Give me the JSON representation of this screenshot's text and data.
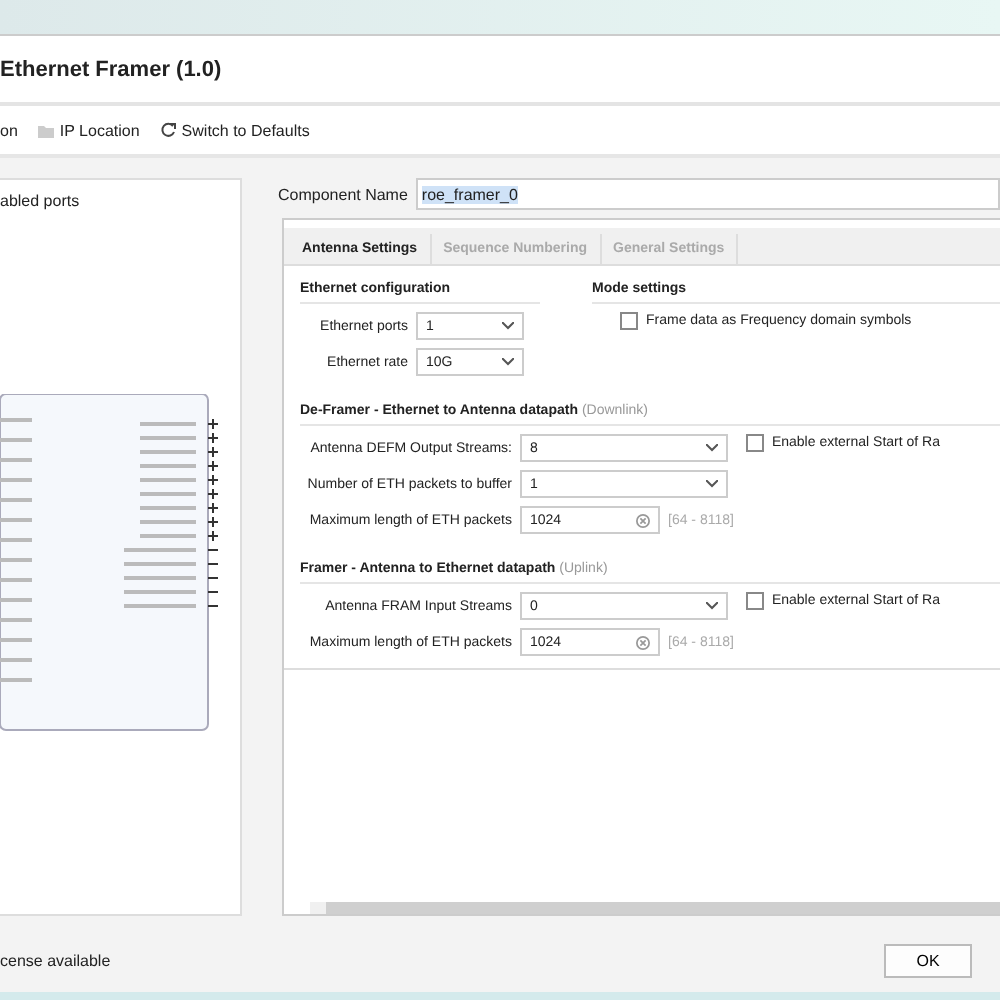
{
  "window": {
    "title": "Ethernet Framer (1.0)"
  },
  "toolbar": [
    {
      "label": "on",
      "kind": "text"
    },
    {
      "label": "IP Location",
      "kind": "folder"
    },
    {
      "label": "Switch to Defaults",
      "kind": "refresh"
    }
  ],
  "left_panel": {
    "header": "abled ports"
  },
  "component_name": {
    "label": "Component Name",
    "value": "roe_framer_0"
  },
  "tabs": [
    {
      "label": "Antenna Settings",
      "selected": true
    },
    {
      "label": "Sequence Numbering",
      "selected": false
    },
    {
      "label": "General Settings",
      "selected": false
    }
  ],
  "ethernet_config": {
    "title": "Ethernet configuration",
    "fields": [
      {
        "label": "Ethernet ports",
        "value": "1"
      },
      {
        "label": "Ethernet rate",
        "value": "10G"
      }
    ]
  },
  "mode_settings": {
    "title": "Mode settings",
    "checkbox": {
      "label": "Frame data as Frequency domain symbols",
      "checked": false
    }
  },
  "sections": [
    {
      "title": "De-Framer - Ethernet to Antenna datapath",
      "note": "(Downlink)",
      "checkbox": {
        "label": "Enable external Start of Ra",
        "checked": false
      },
      "fields": [
        {
          "kind": "select",
          "label": "Antenna DEFM Output Streams:",
          "value": "8"
        },
        {
          "kind": "select",
          "label": "Number of ETH packets to buffer",
          "value": "1"
        },
        {
          "kind": "number",
          "label": "Maximum length of ETH packets",
          "value": "1024",
          "range": "[64 - 8118]"
        }
      ]
    },
    {
      "title": "Framer - Antenna to Ethernet datapath",
      "note": "(Uplink)",
      "checkbox": {
        "label": "Enable external Start of Ra",
        "checked": false
      },
      "fields": [
        {
          "kind": "select",
          "label": "Antenna FRAM Input Streams",
          "value": "0"
        },
        {
          "kind": "number",
          "label": "Maximum length of ETH packets",
          "value": "1024",
          "range": "[64 - 8118]"
        }
      ]
    }
  ],
  "status": "cense available",
  "buttons": [
    "OK"
  ]
}
